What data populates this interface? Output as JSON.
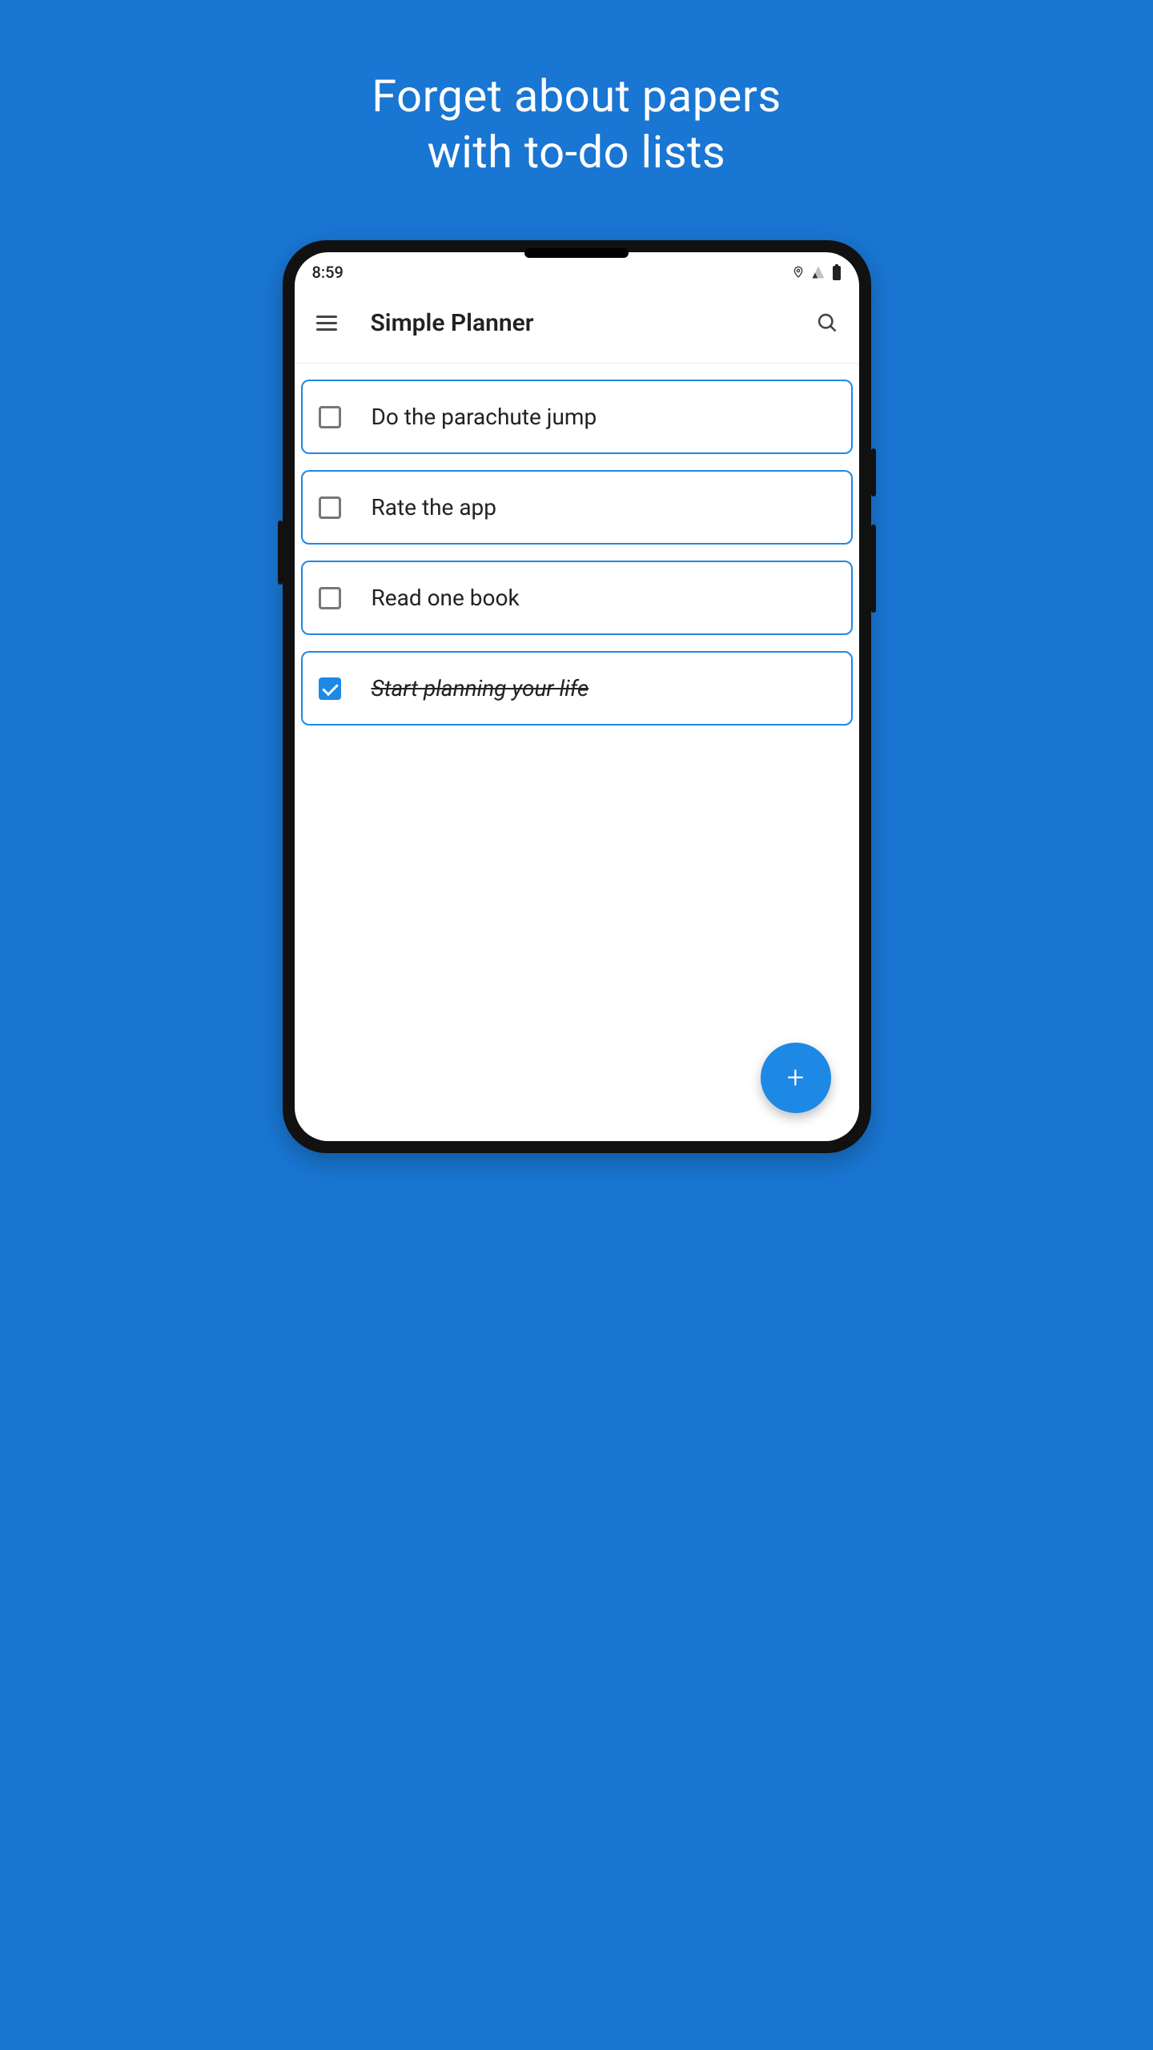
{
  "hero": {
    "line1": "Forget about papers",
    "line2": "with to-do lists"
  },
  "status": {
    "time": "8:59"
  },
  "app": {
    "title": "Simple Planner"
  },
  "tasks": [
    {
      "label": "Do the parachute jump",
      "done": false
    },
    {
      "label": "Rate the app",
      "done": false
    },
    {
      "label": "Read one book",
      "done": false
    },
    {
      "label": "Start planning your life",
      "done": true
    }
  ],
  "colors": {
    "accent": "#1e88e5",
    "bg": "#1976d2"
  }
}
